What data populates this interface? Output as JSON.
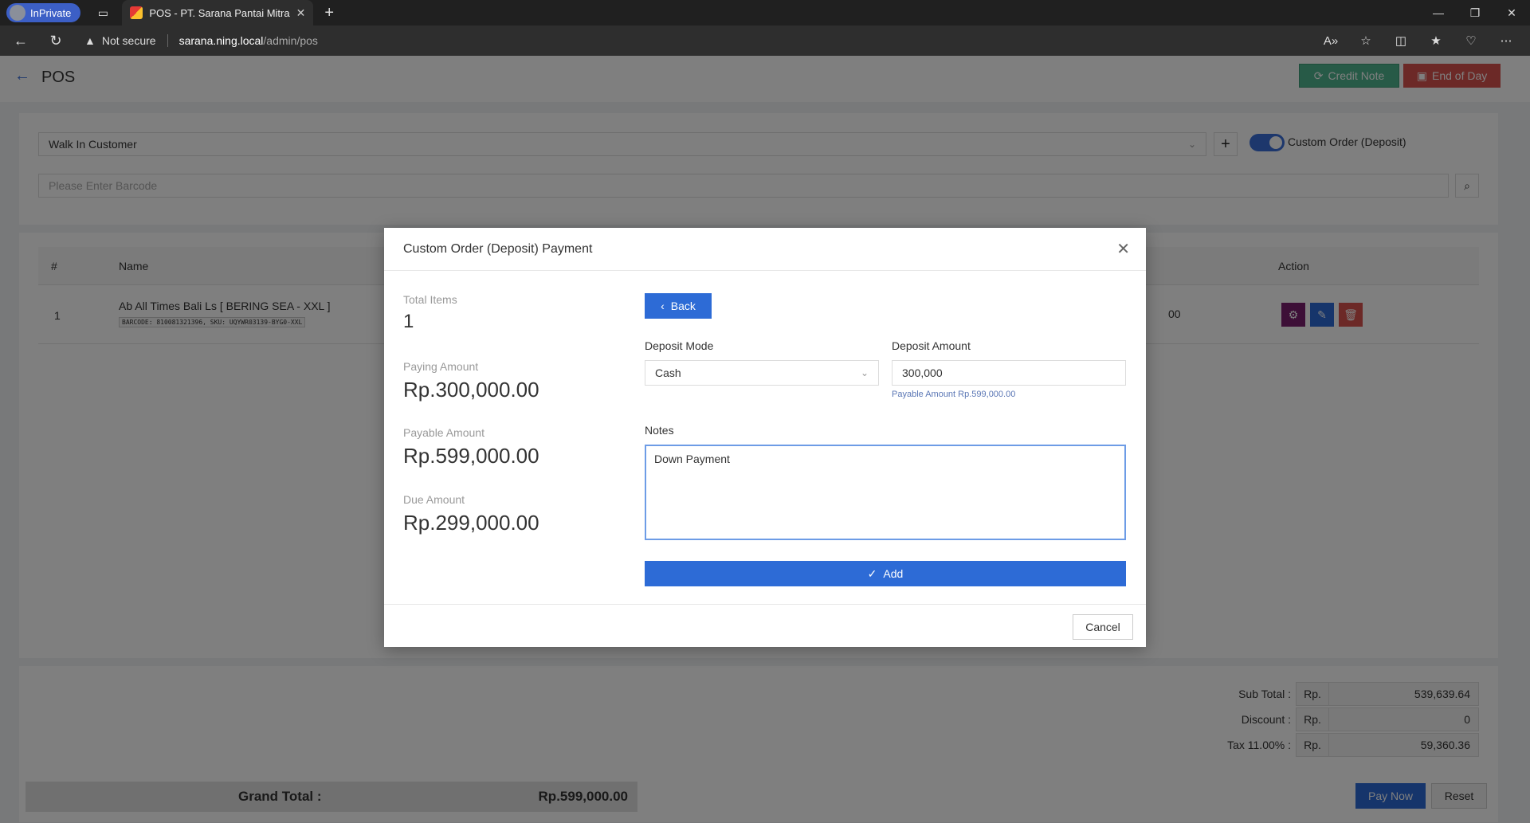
{
  "browser": {
    "inprivate_label": "InPrivate",
    "tab_title": "POS - PT. Sarana Pantai Mitra Se",
    "security_label": "Not secure",
    "url_host": "sarana.ning.local",
    "url_path": "/admin/pos"
  },
  "header": {
    "title": "POS",
    "credit_note_label": "Credit Note",
    "end_of_day_label": "End of Day"
  },
  "customer": {
    "selected": "Walk In Customer",
    "toggle_label": "Custom Order (Deposit)",
    "toggle_on": true,
    "barcode_placeholder": "Please Enter Barcode"
  },
  "table": {
    "columns": [
      "#",
      "Name",
      "Action"
    ],
    "rows": [
      {
        "num": "1",
        "name": "Ab All Times Bali Ls [ BERING SEA - XXL ]",
        "codes": "BARCODE: 810081321396, SKU: UQYWR03139-BYG0-XXL",
        "partial": "00"
      }
    ]
  },
  "totals": {
    "sub_total_label": "Sub Total :",
    "sub_total": "539,639.64",
    "discount_label": "Discount :",
    "discount": "0",
    "tax_label": "Tax 11.00% :",
    "tax": "59,360.36",
    "currency": "Rp.",
    "grand_total_label": "Grand Total :",
    "grand_total": "Rp.599,000.00",
    "pay_now_label": "Pay Now",
    "reset_label": "Reset"
  },
  "modal": {
    "title": "Custom Order (Deposit) Payment",
    "total_items_label": "Total Items",
    "total_items": "1",
    "paying_amount_label": "Paying Amount",
    "paying_amount": "Rp.300,000.00",
    "payable_amount_label": "Payable Amount",
    "payable_amount": "Rp.599,000.00",
    "due_amount_label": "Due Amount",
    "due_amount": "Rp.299,000.00",
    "back_label": "Back",
    "deposit_mode_label": "Deposit Mode",
    "deposit_mode": "Cash",
    "deposit_amount_label": "Deposit Amount",
    "deposit_amount": "300,000",
    "payable_hint": "Payable Amount Rp.599,000.00",
    "notes_label": "Notes",
    "notes": "Down Payment",
    "add_label": "Add",
    "cancel_label": "Cancel"
  },
  "colors": {
    "primary": "#2d6bd6",
    "success": "#4fb58e",
    "danger": "#d9534f",
    "purple": "#7b1f6f"
  }
}
